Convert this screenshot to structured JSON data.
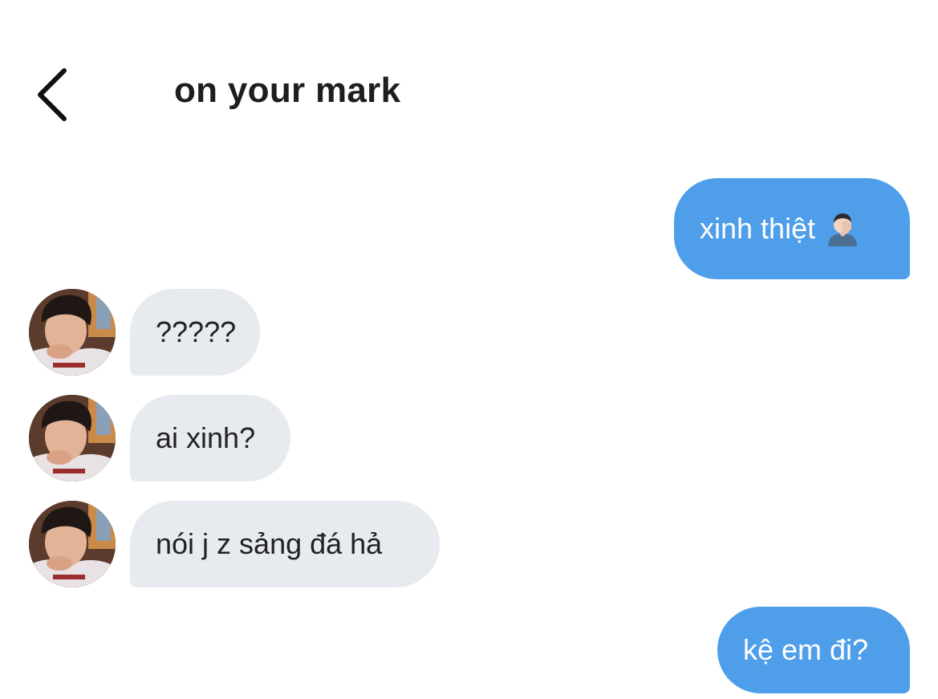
{
  "header": {
    "title": "on your mark",
    "back_icon": "chevron-left-icon"
  },
  "messages": [
    {
      "direction": "outgoing",
      "text": "xinh thiệt",
      "emoji": "person-facepalming-icon"
    },
    {
      "direction": "incoming",
      "text": "?????",
      "avatar": "contact-avatar"
    },
    {
      "direction": "incoming",
      "text": "ai xinh?",
      "avatar": "contact-avatar"
    },
    {
      "direction": "incoming",
      "text": "nói j z sảng đá hả",
      "avatar": "contact-avatar"
    },
    {
      "direction": "outgoing",
      "text": "kệ em đi?"
    }
  ],
  "colors": {
    "outgoing_bubble": "#4e9eea",
    "incoming_bubble": "#e7eaee",
    "background": "#ffffff",
    "title": "#1e1e1e"
  }
}
